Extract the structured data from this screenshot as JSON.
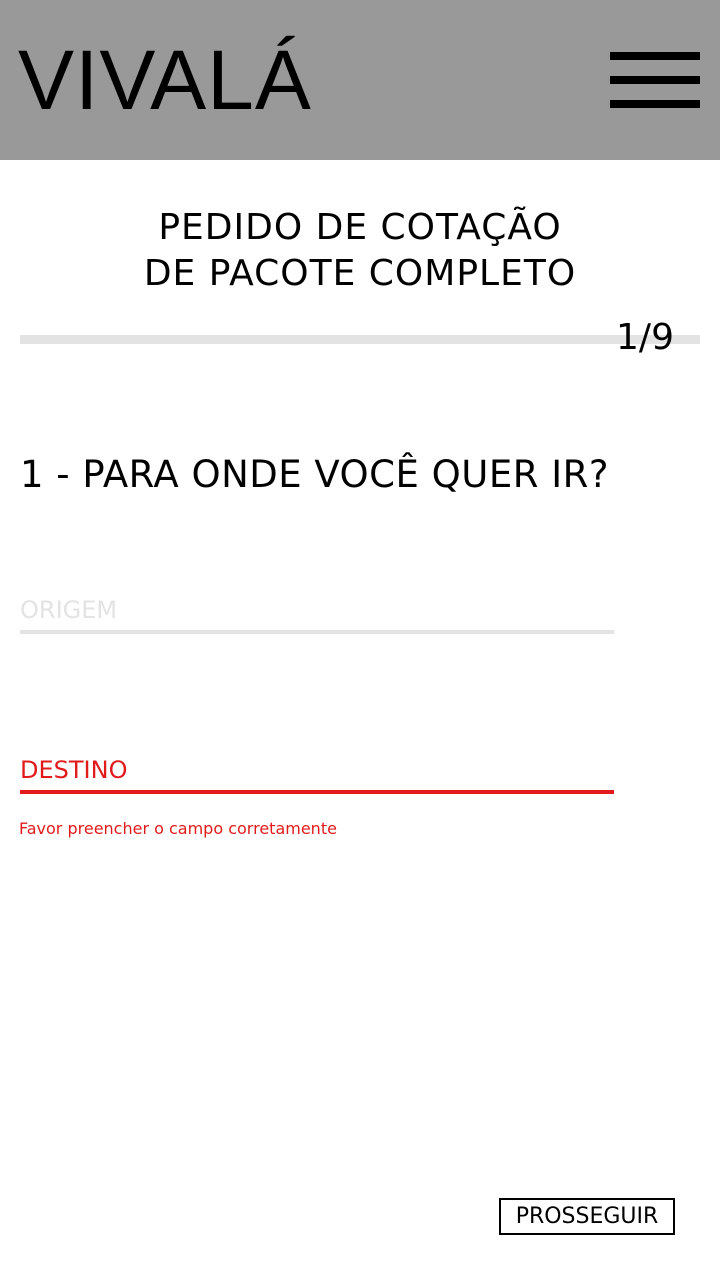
{
  "header": {
    "logo": "VIVALÁ",
    "menu_icon": "hamburger-menu-icon",
    "background_color": "#999999"
  },
  "page": {
    "title_line1": "PEDIDO DE COTAÇÃO",
    "title_line2": "DE PACOTE COMPLETO"
  },
  "progress": {
    "current_step": 1,
    "total_steps": 9,
    "label": "1/9"
  },
  "question": {
    "text": "1 - PARA ONDE VOCÊ QUER IR?"
  },
  "form": {
    "origem": {
      "placeholder": "ORIGEM",
      "value": "",
      "state": "default",
      "color": "#e3e3e3"
    },
    "destino": {
      "placeholder": "DESTINO",
      "value": "",
      "state": "error",
      "color": "#e11b1b",
      "error_message": "Favor preencher o campo corretamente"
    }
  },
  "actions": {
    "next_label": "PROSSEGUIR"
  }
}
